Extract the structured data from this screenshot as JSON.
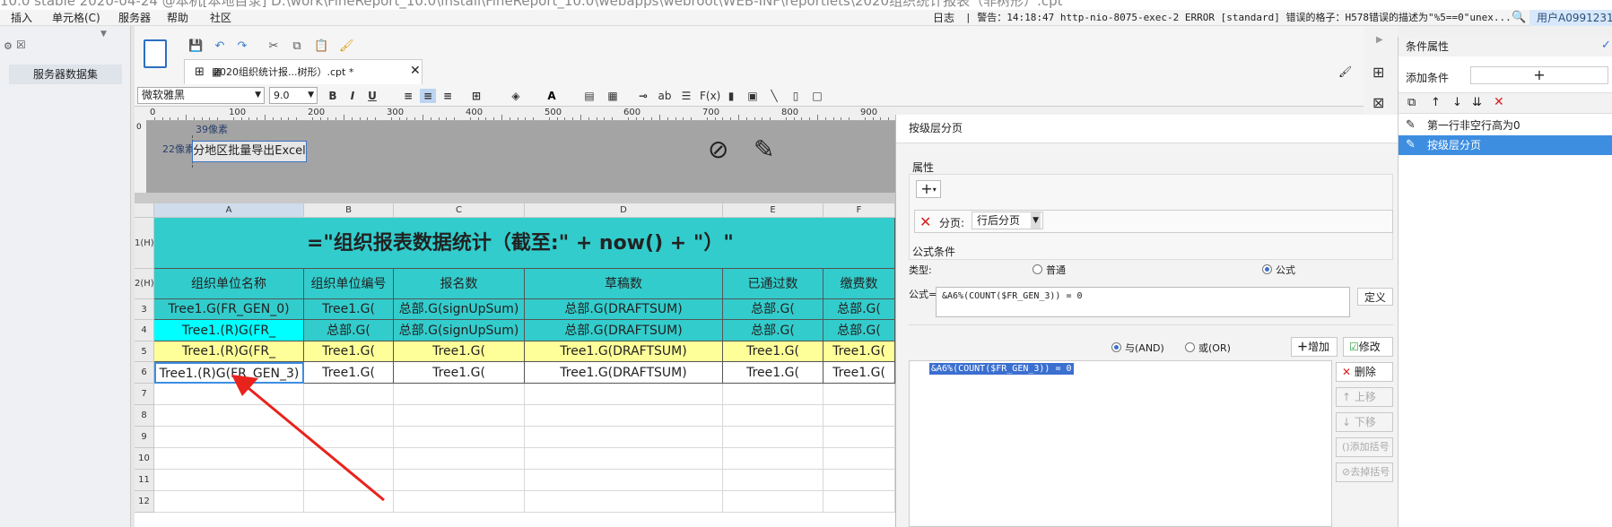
{
  "title_bar": {
    "text": "10.0 stable 2020-04-24 @本机[本地目录]   D:\\work\\FineReport_10.0\\install\\FineReport_10.0\\webapps\\webroot\\WEB-INF\\reportlets\\2020组织统计报表（非树形）.cpt"
  },
  "menu": {
    "items": [
      "插入",
      "单元格(C)",
      "服务器",
      "帮助",
      "社区"
    ]
  },
  "log": {
    "label": "日志",
    "text": "| 警告：14:18:47 http-nio-8075-exec-2 ERROR [standard] 错误的格子：H578错误的描述为\"%5==0\"unex..."
  },
  "user": {
    "label": "用户A0991231"
  },
  "left_panel": {
    "item": "服务器数据集"
  },
  "tab": {
    "label": "2020组织统计报...树形）.cpt *"
  },
  "format_bar": {
    "font": "微软雅黑",
    "size": "9.0"
  },
  "ruler": {
    "ticks": [
      "0",
      "100",
      "200",
      "300",
      "400",
      "500",
      "600",
      "700",
      "800",
      "900",
      "1000",
      "1100",
      "1200",
      "1300"
    ],
    "vtick": "0"
  },
  "canvas": {
    "export_button": "分地区批量导出Excel",
    "label_width": "39像素",
    "label_height": "22像素"
  },
  "grid": {
    "columns": [
      "A",
      "B",
      "C",
      "D",
      "E",
      "F"
    ],
    "rows": [
      "1(H)",
      "2(H)",
      "3",
      "4",
      "5",
      "6",
      "7",
      "8",
      "9",
      "10",
      "11",
      "12"
    ],
    "title": "=\"组织报表数据统计（截至:\" + now() + \"）\"",
    "headers": [
      "组织单位名称",
      "组织单位编号",
      "报名数",
      "草稿数",
      "已通过数",
      "缴费数"
    ],
    "data": [
      [
        "Tree1.G(FR_GEN_0)",
        "Tree1.G(",
        "总部.G(signUpSum)",
        "总部.G(DRAFTSUM)",
        "总部.G(",
        "总部.G("
      ],
      [
        "Tree1.(R)G(FR_",
        "总部.G(",
        "总部.G(signUpSum)",
        "总部.G(DRAFTSUM)",
        "总部.G(",
        "总部.G("
      ],
      [
        "Tree1.(R)G(FR_",
        "Tree1.G(",
        "Tree1.G(",
        "Tree1.G(DRAFTSUM)",
        "Tree1.G(",
        "Tree1.G("
      ],
      [
        "Tree1.(R)G(FR_GEN_3)",
        "Tree1.G(",
        "Tree1.G(",
        "Tree1.G(DRAFTSUM)",
        "Tree1.G(",
        "Tree1.G("
      ]
    ]
  },
  "dialog": {
    "title": "按级层分页",
    "section_attr": "属性",
    "page_label": "分页:",
    "page_value": "行后分页",
    "section_formula": "公式条件",
    "type_label": "类型:",
    "radio_normal": "普通",
    "radio_formula": "公式",
    "formula_label": "公式=",
    "formula_value": "&A6%(COUNT($FR_GEN_3)) = 0",
    "define_btn": "定义",
    "and_label": "与(AND)",
    "or_label": "或(OR)",
    "add_btn": "增加",
    "modify_btn": "修改",
    "condition_item": "&A6%(COUNT($FR_GEN_3)) = 0",
    "delete_btn": "删除",
    "up_btn": "上移",
    "down_btn": "下移",
    "add_paren_btn": "添加括号",
    "remove_paren_btn": "去掉括号"
  },
  "right_panel": {
    "title": "条件属性",
    "add_condition": "添加条件",
    "items": [
      "第一行非空行高为0",
      "按级层分页"
    ]
  },
  "colors": {
    "teal": "#33cccc",
    "cyan": "#00ffff",
    "yellow": "#ffff99",
    "selected": "#3d8ee0"
  }
}
